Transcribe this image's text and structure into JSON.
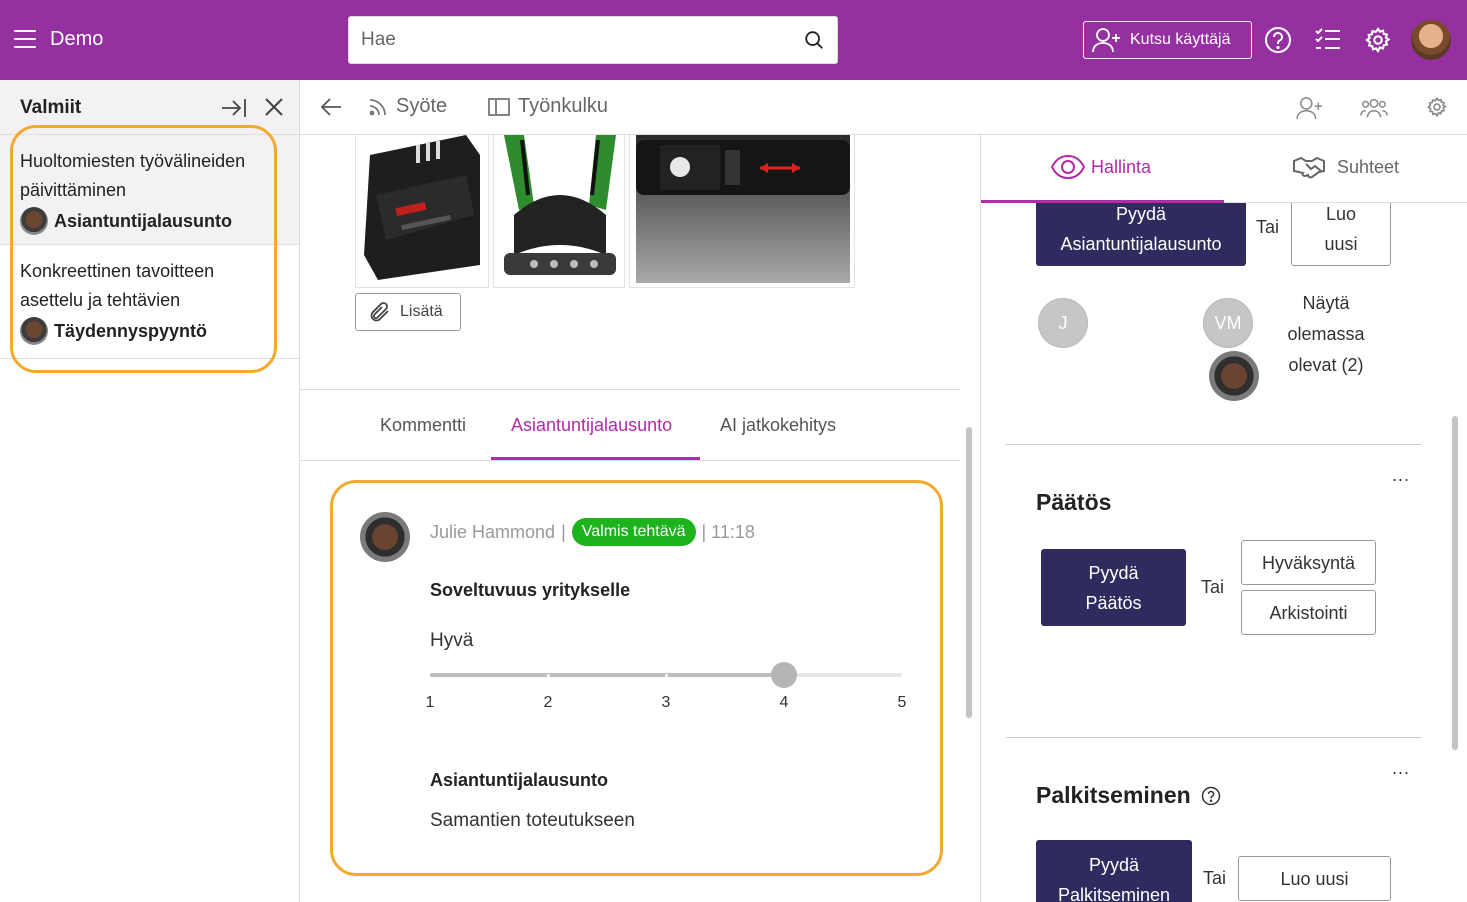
{
  "app": {
    "name": "Demo"
  },
  "search": {
    "placeholder": "Hae"
  },
  "topbar": {
    "invite_label": "Kutsu käyttäjä"
  },
  "left_panel": {
    "title": "Valmiit",
    "items": [
      {
        "title": "Huoltomiesten työvälineiden päivittäminen",
        "subtitle": "Asiantuntijalausunto"
      },
      {
        "title": "Konkreettinen tavoitteen asettelu ja tehtävien",
        "subtitle": "Täydennyspyyntö"
      }
    ]
  },
  "center_header": {
    "tabs": [
      "Syöte",
      "Työnkulku"
    ]
  },
  "attachments": {
    "add_label": "Lisätä"
  },
  "subtabs": {
    "items": [
      "Kommentti",
      "Asiantuntijalausunto",
      "AI jatkokehitys"
    ],
    "active_index": 1
  },
  "comment": {
    "author": "Julie Hammond",
    "separator": "|",
    "status": "Valmis tehtävä",
    "time": "| 11:18",
    "field1_label": "Soveltuvuus yritykselle",
    "field1_value": "Hyvä",
    "slider": {
      "min": 1,
      "max": 5,
      "value": 4,
      "ticks": [
        "1",
        "2",
        "3",
        "4",
        "5"
      ]
    },
    "field2_label": "Asiantuntijalausunto",
    "field2_value": "Samantien toteutukseen"
  },
  "right_panel": {
    "tabs": [
      "Hallinta",
      "Suhteet"
    ],
    "active_tab_index": 0,
    "request_expert": {
      "line1": "Pyydä",
      "line2": "Asiantuntijalausunto"
    },
    "or_label": "Tai",
    "create_new_2line": {
      "line1": "Luo",
      "line2": "uusi"
    },
    "participants": {
      "initials": [
        "J",
        "VM"
      ],
      "show_existing": "Näytä olemassa olevat (2)"
    },
    "decision": {
      "title": "Päätös",
      "request": {
        "line1": "Pyydä",
        "line2": "Päätös"
      },
      "options": [
        "Hyväksyntä",
        "Arkistointi"
      ]
    },
    "reward": {
      "title": "Palkitseminen",
      "request": {
        "line1": "Pyydä",
        "line2": "Palkitseminen"
      },
      "create_new": "Luo uusi"
    },
    "more_label": "..."
  },
  "colors": {
    "brand": "#9530a0",
    "accent": "#b42aa7",
    "dark_button": "#2f2b5e",
    "highlight": "#f2a92e",
    "success": "#1db31d"
  }
}
